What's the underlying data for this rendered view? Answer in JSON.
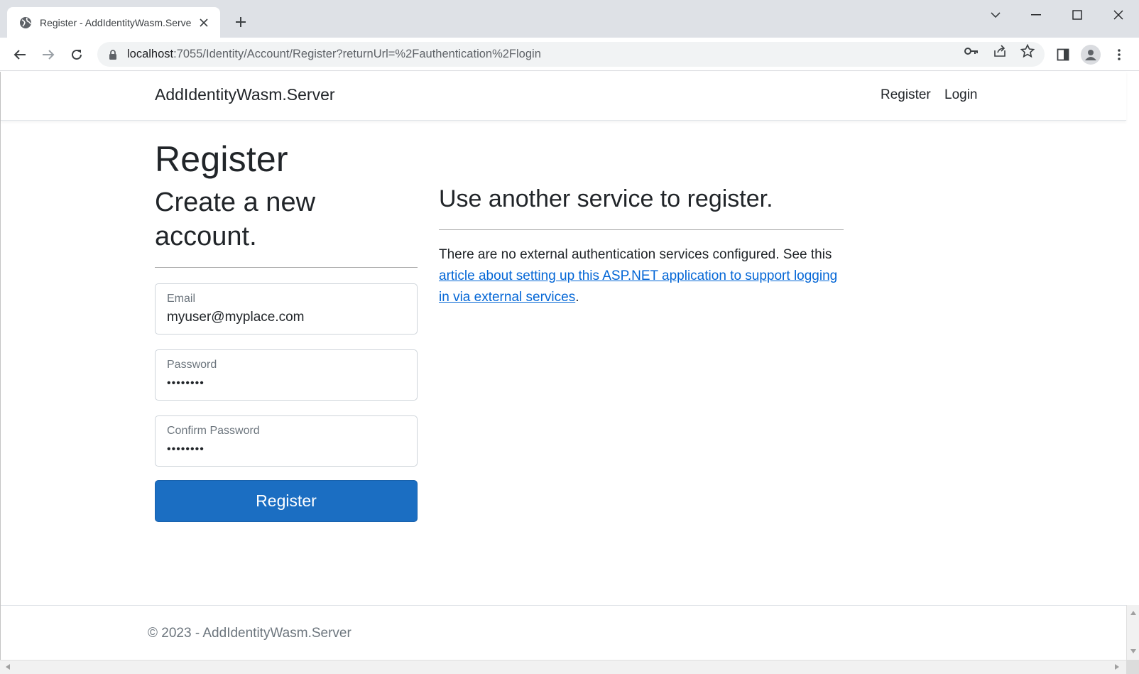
{
  "browser": {
    "tab_title": "Register - AddIdentityWasm.Server",
    "url_host": "localhost",
    "url_rest": ":7055/Identity/Account/Register?returnUrl=%2Fauthentication%2Flogin"
  },
  "site": {
    "brand": "AddIdentityWasm.Server",
    "nav": {
      "register": "Register",
      "login": "Login"
    }
  },
  "page": {
    "title": "Register",
    "left_heading": "Create a new account.",
    "right_heading": "Use another service to register.",
    "email": {
      "label": "Email",
      "value": "myuser@myplace.com"
    },
    "password": {
      "label": "Password",
      "value": "••••••••"
    },
    "confirm_password": {
      "label": "Confirm Password",
      "value": "••••••••"
    },
    "register_button": "Register",
    "external": {
      "text_before": "There are no external authentication services configured. See this ",
      "link_text": "article about setting up this ASP.NET application to support logging in via external services",
      "text_after": "."
    }
  },
  "footer": {
    "text": "© 2023 - AddIdentityWasm.Server"
  },
  "colors": {
    "primary_button": "#1b6ec2",
    "link": "#0366d6",
    "chrome_titlebar": "#dee1e6"
  }
}
